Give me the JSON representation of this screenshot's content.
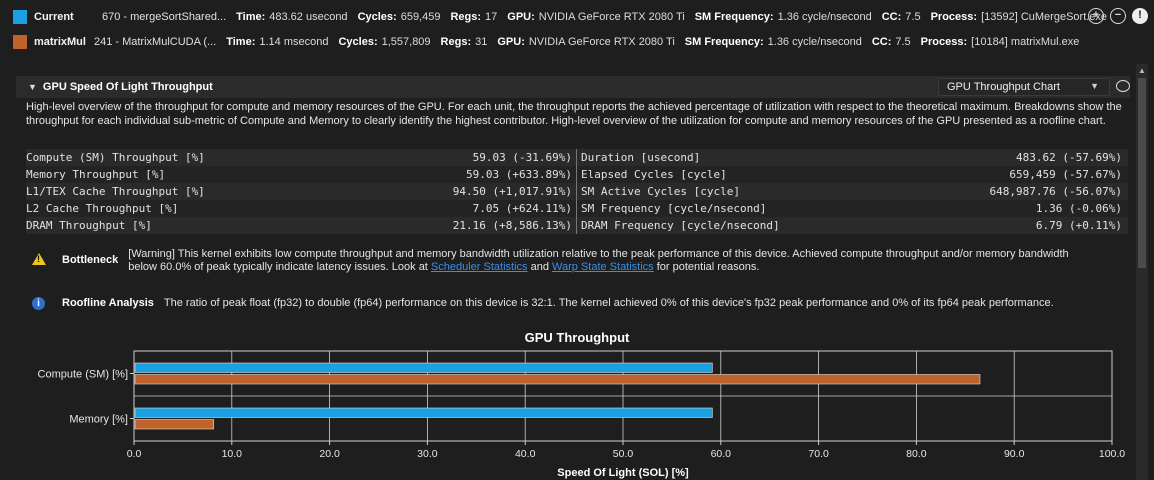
{
  "results": [
    {
      "color": "#1ba1e2",
      "name": "Current",
      "kernel": "670 - mergeSortShared...",
      "time_label": "Time:",
      "time": "483.62 usecond",
      "cycles_label": "Cycles:",
      "cycles": "659,459",
      "regs_label": "Regs:",
      "regs": "17",
      "gpu_label": "GPU:",
      "gpu": "NVIDIA GeForce RTX 2080 Ti",
      "smfreq_label": "SM Frequency:",
      "smfreq": "1.36 cycle/nsecond",
      "cc_label": "CC:",
      "cc": "7.5",
      "process_label": "Process:",
      "process": "[13592] CuMergeSort.exe"
    },
    {
      "color": "#c0622b",
      "name": "matrixMul",
      "kernel": "241 - MatrixMulCUDA (...",
      "time_label": "Time:",
      "time": "1.14 msecond",
      "cycles_label": "Cycles:",
      "cycles": "1,557,809",
      "regs_label": "Regs:",
      "regs": "31",
      "gpu_label": "GPU:",
      "gpu": "NVIDIA GeForce RTX 2080 Ti",
      "smfreq_label": "SM Frequency:",
      "smfreq": "1.36 cycle/nsecond",
      "cc_label": "CC:",
      "cc": "7.5",
      "process_label": "Process:",
      "process": "[10184] matrixMul.exe"
    }
  ],
  "header_icons": [
    "add-baseline-icon",
    "remove-baseline-icon",
    "info-icon"
  ],
  "section": {
    "title": "GPU Speed Of Light Throughput",
    "chart_select": "GPU Throughput Chart",
    "description": "High-level overview of the throughput for compute and memory resources of the GPU. For each unit, the throughput reports the achieved percentage of utilization with respect to the theoretical maximum. Breakdowns show the throughput for each individual sub-metric of Compute and Memory to clearly identify the highest contributor. High-level overview of the utilization for compute and memory resources of the GPU presented as a roofline chart."
  },
  "metrics": [
    {
      "name": "Compute (SM) Throughput [%]",
      "value": "59.03  (-31.69%)",
      "name2": "Duration [usecond]",
      "value2": "483.62  (-57.69%)"
    },
    {
      "name": "Memory Throughput [%]",
      "value": "59.03 (+633.89%)",
      "name2": "Elapsed Cycles [cycle]",
      "value2": "659,459  (-57.67%)"
    },
    {
      "name": "L1/TEX Cache Throughput [%]",
      "value": "94.50 (+1,017.91%)",
      "name2": "SM Active Cycles [cycle]",
      "value2": "648,987.76  (-56.07%)"
    },
    {
      "name": "L2 Cache Throughput [%]",
      "value": "7.05 (+624.11%)",
      "name2": "SM Frequency [cycle/nsecond]",
      "value2": "1.36   (-0.06%)"
    },
    {
      "name": "DRAM Throughput [%]",
      "value": "21.16 (+8,586.13%)",
      "name2": "DRAM Frequency [cycle/nsecond]",
      "value2": "6.79   (+0.11%)"
    }
  ],
  "bottleneck": {
    "title": "Bottleneck",
    "text_before": "[Warning] This kernel exhibits low compute throughput and memory bandwidth utilization relative to the peak performance of this device. Achieved compute throughput and/or memory bandwidth below 60.0% of peak typically indicate latency issues. Look at ",
    "link1": "Scheduler Statistics",
    "text_mid": " and ",
    "link2": "Warp State Statistics",
    "text_after": " for potential reasons."
  },
  "roofline": {
    "title": "Roofline Analysis",
    "text": "The ratio of peak float (fp32) to double (fp64) performance on this device is 32:1. The kernel achieved 0% of this device's fp32 peak performance and 0% of its fp64 peak performance."
  },
  "chart_data": {
    "type": "bar",
    "orientation": "horizontal",
    "title": "GPU Throughput",
    "xlabel": "Speed Of Light (SOL) [%]",
    "ylabel": "",
    "xlim": [
      0,
      100
    ],
    "ticks": [
      "0.0",
      "10.0",
      "20.0",
      "30.0",
      "40.0",
      "50.0",
      "60.0",
      "70.0",
      "80.0",
      "90.0",
      "100.0"
    ],
    "categories": [
      "Compute (SM) [%]",
      "Memory [%]"
    ],
    "series": [
      {
        "name": "Current",
        "color": "#1ba1e2",
        "values": [
          59.03,
          59.03
        ]
      },
      {
        "name": "matrixMul",
        "color": "#c0622b",
        "values": [
          86.4,
          8.05
        ]
      }
    ],
    "grid": true
  }
}
